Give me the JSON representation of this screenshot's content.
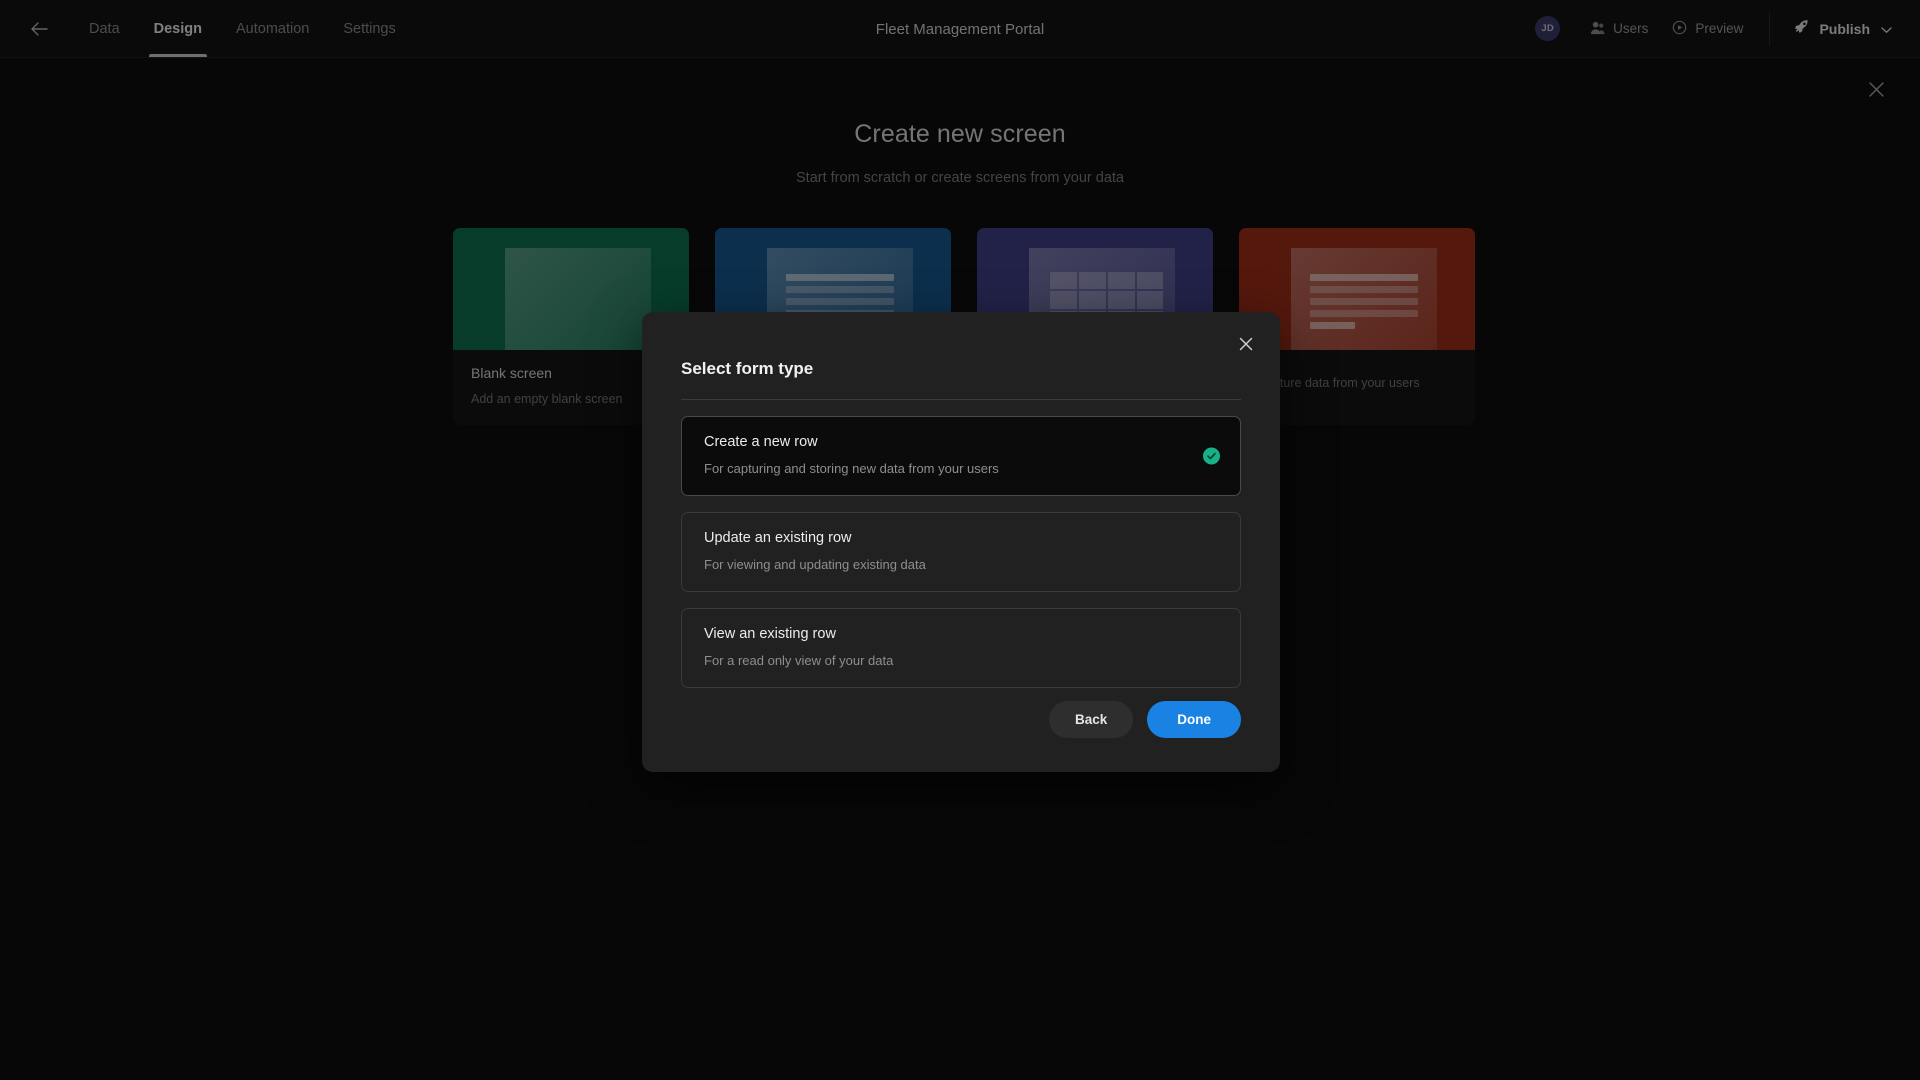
{
  "header": {
    "back_icon": "arrow-left-icon",
    "tabs": [
      {
        "label": "Data",
        "active": false
      },
      {
        "label": "Design",
        "active": true
      },
      {
        "label": "Automation",
        "active": false
      },
      {
        "label": "Settings",
        "active": false
      }
    ],
    "app_title": "Fleet Management Portal",
    "avatar_initials": "JD",
    "users_label": "Users",
    "preview_label": "Preview",
    "publish_label": "Publish"
  },
  "page": {
    "close_icon": "close-icon",
    "title": "Create new screen",
    "subtitle": "Start from scratch or create screens from your data"
  },
  "cards": [
    {
      "title": "Blank screen",
      "desc": "Add an empty blank screen",
      "color": "#0d6e4e",
      "art": "blank"
    },
    {
      "title": "",
      "desc": "",
      "color": "#17578c",
      "art": "form"
    },
    {
      "title": "",
      "desc": "",
      "color": "#3f3e86",
      "art": "table"
    },
    {
      "title": "",
      "desc": "Capture data from your users",
      "color": "#9c2c18",
      "art": "fields"
    }
  ],
  "modal": {
    "title": "Select form type",
    "close_icon": "close-icon",
    "options": [
      {
        "title": "Create a new row",
        "desc": "For capturing and storing new data from your users",
        "selected": true
      },
      {
        "title": "Update an existing row",
        "desc": "For viewing and updating existing data",
        "selected": false
      },
      {
        "title": "View an existing row",
        "desc": "For a read only view of your data",
        "selected": false
      }
    ],
    "back_label": "Back",
    "done_label": "Done",
    "accent_color": "#1a82e2",
    "check_color": "#16b287"
  }
}
